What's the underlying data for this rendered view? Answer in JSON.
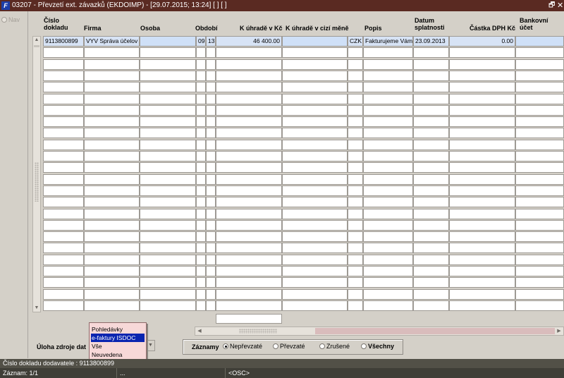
{
  "window": {
    "title": "03207 - Převzetí ext. závazků (EKDOIMP) - [29.07.2015; 13:24] [ ] [ ]",
    "app_icon": "F",
    "restore_glyph": "🗗",
    "close_glyph": "✕"
  },
  "nav": {
    "label": "Nav"
  },
  "columns": {
    "cislo_dokladu": [
      "Číslo",
      "dokladu"
    ],
    "firma": "Firma",
    "osoba": "Osoba",
    "obdobi": "Období",
    "k_uhrade_kc": "K úhradě v Kč",
    "k_uhrade_cm": "K úhradě v cizí měně",
    "popis": "Popis",
    "datum_splatnosti": [
      "Datum",
      "splatnosti"
    ],
    "castka_dph": "Částka DPH Kč",
    "bankovni_ucet": [
      "Bankovní",
      "účet"
    ]
  },
  "rows": [
    {
      "cislo_dokladu": "9113800899",
      "firma": "VYV Správa účelov",
      "osoba": "",
      "obdobi_m": "09",
      "obdobi_r": "13",
      "k_uhrade_kc": "46 400.00",
      "k_uhrade_cm": "",
      "mena": "CZK",
      "popis": "Fakturujeme Vám",
      "datum_splatnosti": "23.09.2013",
      "castka_dph": "0.00",
      "bankovni_ucet": ""
    }
  ],
  "controls": {
    "task_label": "Úloha zdroje dat",
    "task_options": [
      "Pohledávky",
      "e-faktury ISDOC",
      "Vše",
      "Neuvedena"
    ],
    "task_selected": "e-faktury ISDOC",
    "records_label": "Záznamy",
    "record_filters": [
      "Nepřevzaté",
      "Převzaté",
      "Zrušené",
      "Všechny"
    ],
    "record_filter_selected": "Nepřevzaté"
  },
  "status": {
    "line1": "Číslo dokladu dodavatele : 9113800899",
    "record": "Záznam: 1/1",
    "seg2": "...",
    "seg3": "<OSC>"
  },
  "colors": {
    "titlebar": "#5a2a22",
    "selection": "#0a24b0",
    "dropdown_bg": "#f7d8d8",
    "status_bg": "#3f3e37"
  }
}
